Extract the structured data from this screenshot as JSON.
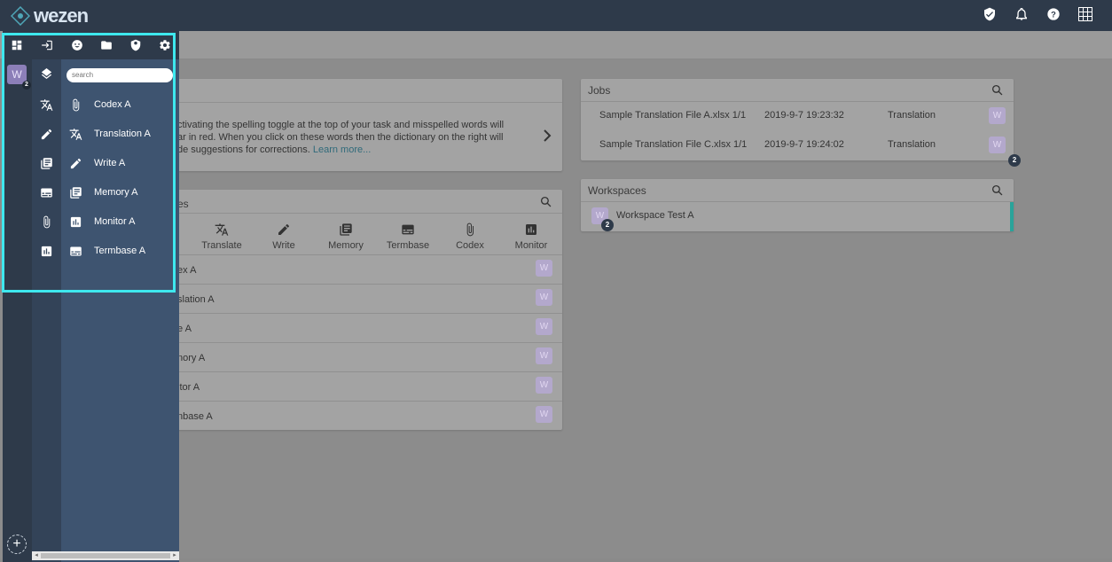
{
  "app": {
    "logo_text": "wezen"
  },
  "topbar": {
    "icons": [
      "shield-check-icon",
      "bell-icon",
      "help-icon",
      "apps-grid-icon"
    ]
  },
  "drawer": {
    "top_icons": [
      "dashboard-icon",
      "login-icon",
      "emoji-icon",
      "folder-icon",
      "shield-icon",
      "gear-icon"
    ],
    "workspace_badge": "W",
    "workspace_count": "2",
    "search_placeholder": "search",
    "rail_icons": [
      "layers-icon",
      "translate-icon",
      "pencil-icon",
      "library-icon",
      "subtitles-icon",
      "paperclip-icon",
      "bar-chart-icon"
    ],
    "items": [
      {
        "label": "Codex A",
        "icon": "paperclip-icon"
      },
      {
        "label": "Translation A",
        "icon": "translate-icon"
      },
      {
        "label": "Write A",
        "icon": "pencil-icon"
      },
      {
        "label": "Memory A",
        "icon": "library-icon"
      },
      {
        "label": "Monitor A",
        "icon": "bar-chart-icon"
      },
      {
        "label": "Termbase A",
        "icon": "subtitles-icon"
      }
    ],
    "add_label": "+",
    "scroll_left": "◂",
    "scroll_right": "▸"
  },
  "intro": {
    "line1": "ctivating the spelling toggle at the top of your task and misspelled words will",
    "line2": "ar in red. When you click on these words then the dictionary on the right will",
    "line3": "de suggestions for corrections. ",
    "link": "Learn more..."
  },
  "services": {
    "title": "es",
    "tabs": [
      {
        "label": "Translate",
        "icon": "translate-icon"
      },
      {
        "label": "Write",
        "icon": "pencil-icon"
      },
      {
        "label": "Memory",
        "icon": "library-icon"
      },
      {
        "label": "Termbase",
        "icon": "subtitles-icon"
      },
      {
        "label": "Codex",
        "icon": "paperclip-icon"
      },
      {
        "label": "Monitor",
        "icon": "bar-chart-icon"
      }
    ],
    "rows": [
      "ex A",
      "slation A",
      "e A",
      "nory A",
      "itor A",
      "nbase A"
    ],
    "badge": "W"
  },
  "jobs": {
    "title": "Jobs",
    "rows": [
      {
        "name": "Sample Translation File A.xlsx 1/1",
        "time": "2019-9-7 19:23:32",
        "type": "Translation"
      },
      {
        "name": "Sample Translation File C.xlsx 1/1",
        "time": "2019-9-7 19:24:02",
        "type": "Translation"
      }
    ],
    "badge": "W",
    "count": "2"
  },
  "workspaces": {
    "title": "Workspaces",
    "rows": [
      {
        "name": "Workspace Test A",
        "badge": "W",
        "count": "2"
      }
    ]
  },
  "colors": {
    "topbar": "#2e3a4a",
    "panel": "#3e5470",
    "highlight": "#3ee8ee",
    "accent": "#2aa39a"
  }
}
